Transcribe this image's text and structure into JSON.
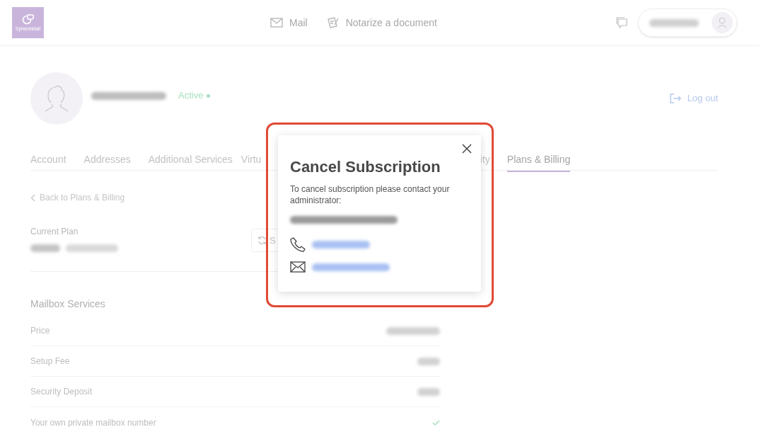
{
  "header": {
    "logo_text": "SphereMail",
    "nav": [
      {
        "kind": "mail",
        "label": "Mail"
      },
      {
        "kind": "notarize",
        "label": "Notarize a document"
      }
    ]
  },
  "profile": {
    "status": "Active",
    "logout": "Log out"
  },
  "tabs": [
    {
      "label": "Account",
      "selected": false
    },
    {
      "label": "Addresses",
      "selected": false
    },
    {
      "label": "Additional Services",
      "selected": false
    },
    {
      "label": "Virtu",
      "selected": false
    },
    {
      "label": "ity",
      "selected": false
    },
    {
      "label": "Plans & Billing",
      "selected": true
    }
  ],
  "back_link": "Back to Plans & Billing",
  "current_plan": {
    "label": "Current Plan",
    "button_label": "S"
  },
  "section": {
    "title": "Mailbox Services",
    "rows": [
      {
        "label": "Price",
        "kind": "value"
      },
      {
        "label": "Setup Fee",
        "kind": "value"
      },
      {
        "label": "Security Deposit",
        "kind": "value"
      },
      {
        "label": "Your own private mailbox number",
        "kind": "check"
      }
    ]
  },
  "modal": {
    "title": "Cancel Subscription",
    "message": "To cancel subscription please contact your administrator:",
    "contacts": [
      {
        "kind": "phone"
      },
      {
        "kind": "email"
      }
    ]
  }
}
